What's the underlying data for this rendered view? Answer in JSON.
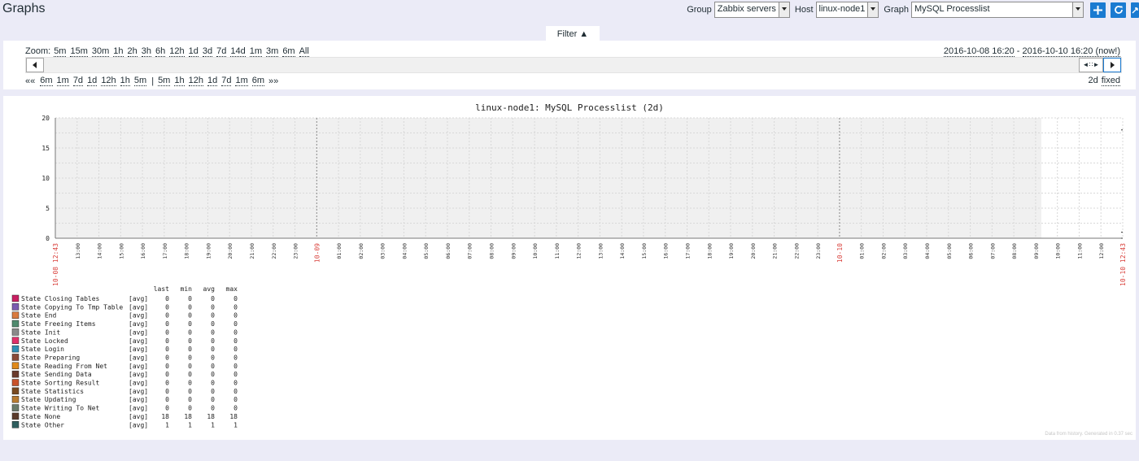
{
  "page": {
    "title": "Graphs"
  },
  "header": {
    "group_label": "Group",
    "group_value": "Zabbix servers",
    "host_label": "Host",
    "host_value": "linux-node1",
    "graph_label": "Graph",
    "graph_value": "MySQL Processlist",
    "icons": [
      "plus-icon",
      "refresh-icon",
      "fullscreen-icon"
    ]
  },
  "filter": {
    "tab_label": "Filter ▲",
    "zoom_label": "Zoom:",
    "zoom_options": [
      "5m",
      "15m",
      "30m",
      "1h",
      "2h",
      "3h",
      "6h",
      "12h",
      "1d",
      "3d",
      "7d",
      "14d",
      "1m",
      "3m",
      "6m",
      "All"
    ],
    "range_from": "2016-10-08 16:20",
    "range_separator": " - ",
    "range_to": "2016-10-10 16:20 (now!)",
    "back_prefix": "««",
    "back_options": [
      "6m",
      "1m",
      "7d",
      "1d",
      "12h",
      "1h",
      "5m"
    ],
    "divider": "|",
    "forward_options": [
      "5m",
      "1h",
      "12h",
      "1d",
      "7d",
      "1m",
      "6m"
    ],
    "forward_suffix": "»»",
    "period_label": "2d",
    "fixed_label": "fixed",
    "thumb_glyph": "◄∷►"
  },
  "colors": {
    "background": "#ebebf7",
    "accent": "#1b7bd1",
    "plot_area": "#f0f0f0",
    "tick_red": "#d9403b"
  },
  "chart_data": {
    "type": "line",
    "title": "linux-node1: MySQL Processlist (2d)",
    "ylim": [
      0,
      20
    ],
    "y_ticks": [
      0,
      5,
      10,
      15,
      20
    ],
    "x_ticks": [
      "10-08 12:43",
      "13:00",
      "14:00",
      "15:00",
      "16:00",
      "17:00",
      "18:00",
      "19:00",
      "20:00",
      "21:00",
      "22:00",
      "23:00",
      "10-09",
      "01:00",
      "02:00",
      "03:00",
      "04:00",
      "05:00",
      "06:00",
      "07:00",
      "08:00",
      "09:00",
      "10:00",
      "11:00",
      "12:00",
      "13:00",
      "14:00",
      "15:00",
      "16:00",
      "17:00",
      "18:00",
      "19:00",
      "20:00",
      "21:00",
      "22:00",
      "23:00",
      "10-10",
      "01:00",
      "02:00",
      "03:00",
      "04:00",
      "05:00",
      "06:00",
      "07:00",
      "08:00",
      "09:00",
      "10:00",
      "11:00",
      "12:00",
      "10-10 12:43"
    ],
    "red_ticks": [
      "10-08 12:43",
      "10-09",
      "10-10",
      "10-10 12:43"
    ],
    "grid": true,
    "legend_headers": [
      "last",
      "min",
      "avg",
      "max"
    ],
    "series": [
      {
        "name": "State Closing Tables",
        "agg": "[avg]",
        "color": "#c91f62",
        "last": 0,
        "min": 0,
        "avg": 0,
        "max": 0
      },
      {
        "name": "State Copying To Tmp Table",
        "agg": "[avg]",
        "color": "#7a5bb0",
        "last": 0,
        "min": 0,
        "avg": 0,
        "max": 0
      },
      {
        "name": "State End",
        "agg": "[avg]",
        "color": "#d97a3e",
        "last": 0,
        "min": 0,
        "avg": 0,
        "max": 0
      },
      {
        "name": "State Freeing Items",
        "agg": "[avg]",
        "color": "#4f8a6e",
        "last": 0,
        "min": 0,
        "avg": 0,
        "max": 0
      },
      {
        "name": "State Init",
        "agg": "[avg]",
        "color": "#8a8a8a",
        "last": 0,
        "min": 0,
        "avg": 0,
        "max": 0
      },
      {
        "name": "State Locked",
        "agg": "[avg]",
        "color": "#e0306a",
        "last": 0,
        "min": 0,
        "avg": 0,
        "max": 0
      },
      {
        "name": "State Login",
        "agg": "[avg]",
        "color": "#2f8fb5",
        "last": 0,
        "min": 0,
        "avg": 0,
        "max": 0
      },
      {
        "name": "State Preparing",
        "agg": "[avg]",
        "color": "#8a4a38",
        "last": 0,
        "min": 0,
        "avg": 0,
        "max": 0
      },
      {
        "name": "State Reading From Net",
        "agg": "[avg]",
        "color": "#e08a1a",
        "last": 0,
        "min": 0,
        "avg": 0,
        "max": 0
      },
      {
        "name": "State Sending Data",
        "agg": "[avg]",
        "color": "#6a3a2c",
        "last": 0,
        "min": 0,
        "avg": 0,
        "max": 0
      },
      {
        "name": "State Sorting Result",
        "agg": "[avg]",
        "color": "#c9522a",
        "last": 0,
        "min": 0,
        "avg": 0,
        "max": 0
      },
      {
        "name": "State Statistics",
        "agg": "[avg]",
        "color": "#7a4a20",
        "last": 0,
        "min": 0,
        "avg": 0,
        "max": 0
      },
      {
        "name": "State Updating",
        "agg": "[avg]",
        "color": "#b87a30",
        "last": 0,
        "min": 0,
        "avg": 0,
        "max": 0
      },
      {
        "name": "State Writing To Net",
        "agg": "[avg]",
        "color": "#6a7a6a",
        "last": 0,
        "min": 0,
        "avg": 0,
        "max": 0
      },
      {
        "name": "State None",
        "agg": "[avg]",
        "color": "#5a3a2a",
        "last": 18,
        "min": 18,
        "avg": 18,
        "max": 18
      },
      {
        "name": "State Other",
        "agg": "[avg]",
        "color": "#2f5f5f",
        "last": 1,
        "min": 1,
        "avg": 1,
        "max": 1
      }
    ]
  },
  "footnote": "Data from history. Generated in 0.37 sec"
}
